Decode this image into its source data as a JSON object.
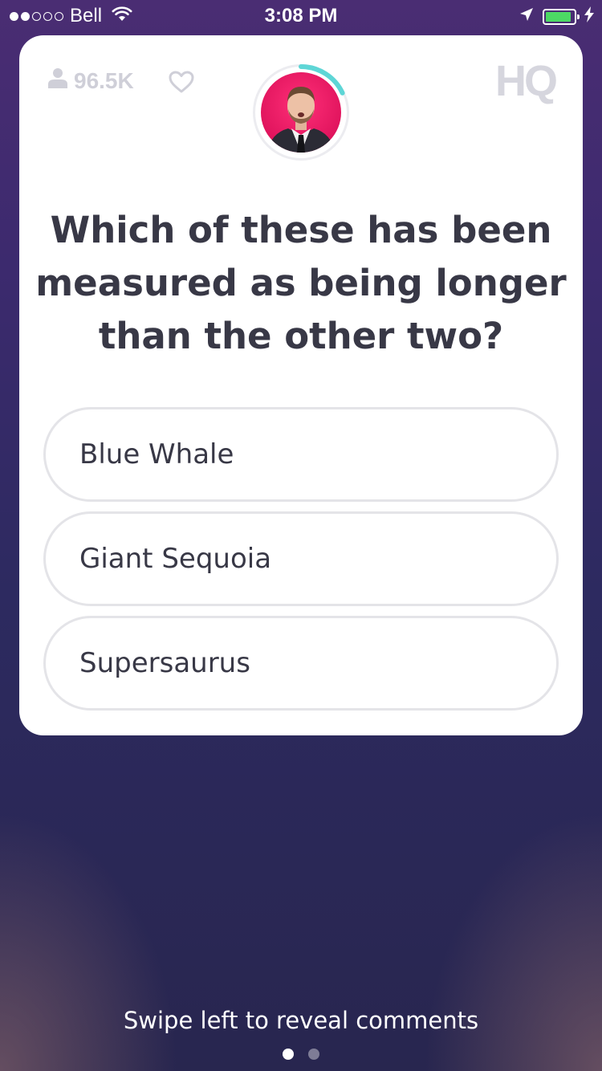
{
  "status_bar": {
    "carrier": "Bell",
    "time": "3:08 PM",
    "signal_filled": 2,
    "signal_total": 5,
    "battery_level": 0.9,
    "battery_color": "#4cd964"
  },
  "header": {
    "viewer_count": "96.5K",
    "logo": "HQ",
    "timer_progress": 0.18,
    "timer_color": "#5ed6d6"
  },
  "question": {
    "text": "Which of these has been measured as being longer than the other two?"
  },
  "answers": [
    {
      "label": "Blue Whale"
    },
    {
      "label": "Giant Sequoia"
    },
    {
      "label": "Supersaurus"
    }
  ],
  "footer": {
    "hint": "Swipe left to reveal comments",
    "page_count": 2,
    "active_page": 1
  },
  "icons": {
    "viewers": "person-icon",
    "like": "heart-icon",
    "wifi": "wifi-icon",
    "location": "location-arrow-icon",
    "charging": "lightning-bolt-icon"
  }
}
